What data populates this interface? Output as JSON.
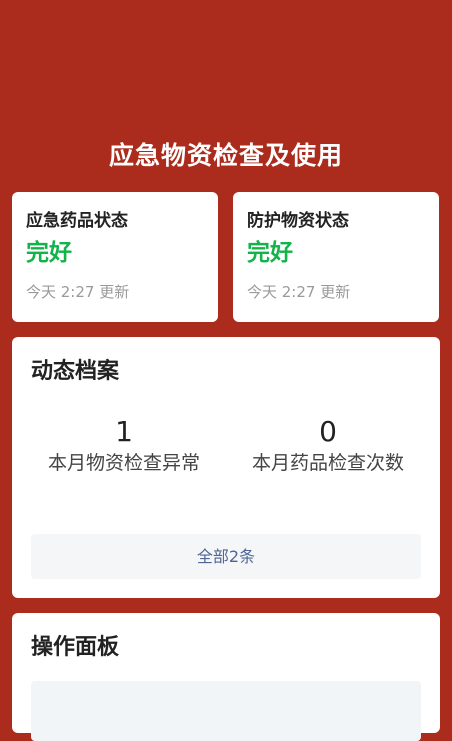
{
  "header": {
    "title": "应急物资检查及使用"
  },
  "status_cards": [
    {
      "title": "应急药品状态",
      "value": "完好",
      "updated": "今天 2:27 更新"
    },
    {
      "title": "防护物资状态",
      "value": "完好",
      "updated": "今天 2:27 更新"
    }
  ],
  "records": {
    "title": "动态档案",
    "stats": [
      {
        "value": "1",
        "label": "本月物资检查异常"
      },
      {
        "value": "0",
        "label": "本月药品检查次数"
      }
    ],
    "view_all": "全部2条"
  },
  "panel": {
    "title": "操作面板"
  },
  "colors": {
    "background": "#ab2c1d",
    "status_ok": "#12b349",
    "link": "#4f6694"
  }
}
